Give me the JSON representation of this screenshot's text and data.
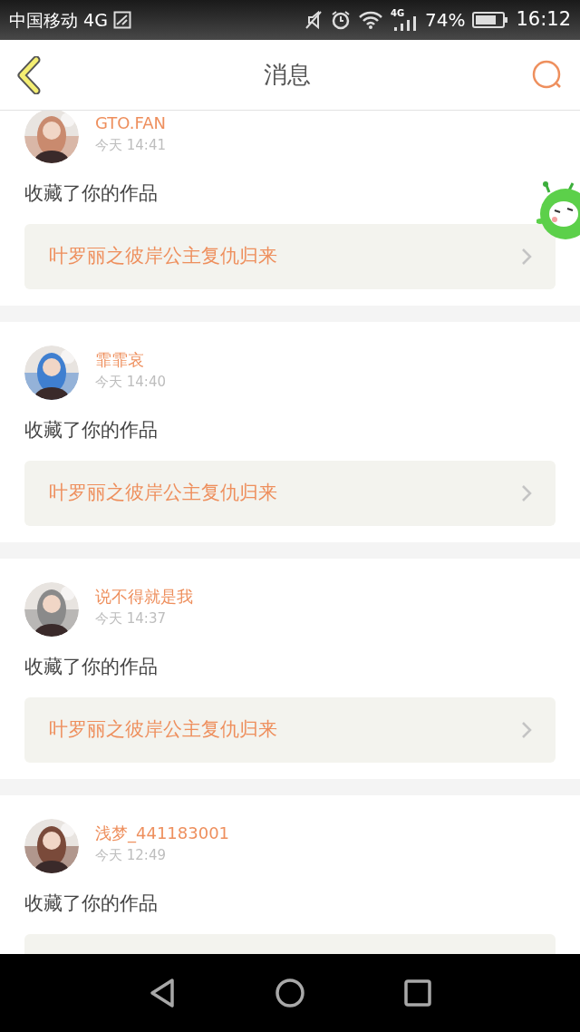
{
  "status_bar": {
    "carrier": "中国移动 4G",
    "network_label": "4G",
    "battery": "74%",
    "time": "16:12"
  },
  "header": {
    "title": "消息"
  },
  "messages": [
    {
      "user": "GTO.FAN",
      "time": "今天 14:41",
      "action": "收藏了你的作品",
      "work": "叶罗丽之彼岸公主复仇归来"
    },
    {
      "user": "霏霏哀",
      "time": "今天 14:40",
      "action": "收藏了你的作品",
      "work": "叶罗丽之彼岸公主复仇归来"
    },
    {
      "user": "说不得就是我",
      "time": "今天 14:37",
      "action": "收藏了你的作品",
      "work": "叶罗丽之彼岸公主复仇归来"
    },
    {
      "user": "浅梦_441183001",
      "time": "今天 12:49",
      "action": "收藏了你的作品"
    }
  ]
}
